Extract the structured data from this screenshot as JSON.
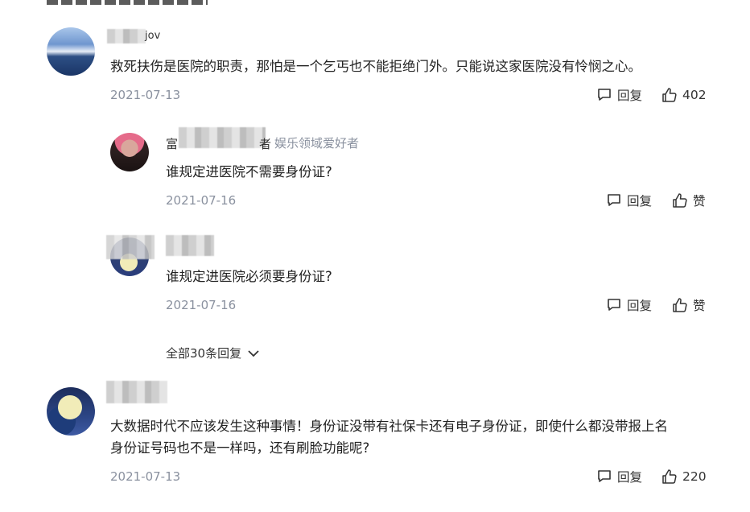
{
  "comments": [
    {
      "username_tail": "jov",
      "text": "救死扶伤是医院的职责，那怕是一个乞丐也不能拒绝门外。只能说这家医院没有怜悯之心。",
      "date": "2021-07-13",
      "reply_label": "回复",
      "like_count": "402",
      "replies": [
        {
          "username_head": "富",
          "username_tail": "者",
          "tag": "娱乐领域爱好者",
          "text": "谁规定进医院不需要身份证?",
          "date": "2021-07-16",
          "reply_label": "回复",
          "like_label": "赞"
        },
        {
          "text": "谁规定进医院必须要身份证?",
          "date": "2021-07-16",
          "reply_label": "回复",
          "like_label": "赞"
        }
      ],
      "more_replies_label": "全部30条回复"
    },
    {
      "text_line1": "大数据时代不应该发生这种事情！身份证没带有社保卡还有电子身份证，即使什么都没带报上名",
      "text_line2": "身份证号码也不是一样吗，还有刷脸功能呢?",
      "date": "2021-07-13",
      "reply_label": "回复",
      "like_count": "220"
    }
  ],
  "icons": {
    "reply": "comment-bubble-icon",
    "like": "thumbs-up-icon",
    "expand": "chevron-down-icon"
  }
}
